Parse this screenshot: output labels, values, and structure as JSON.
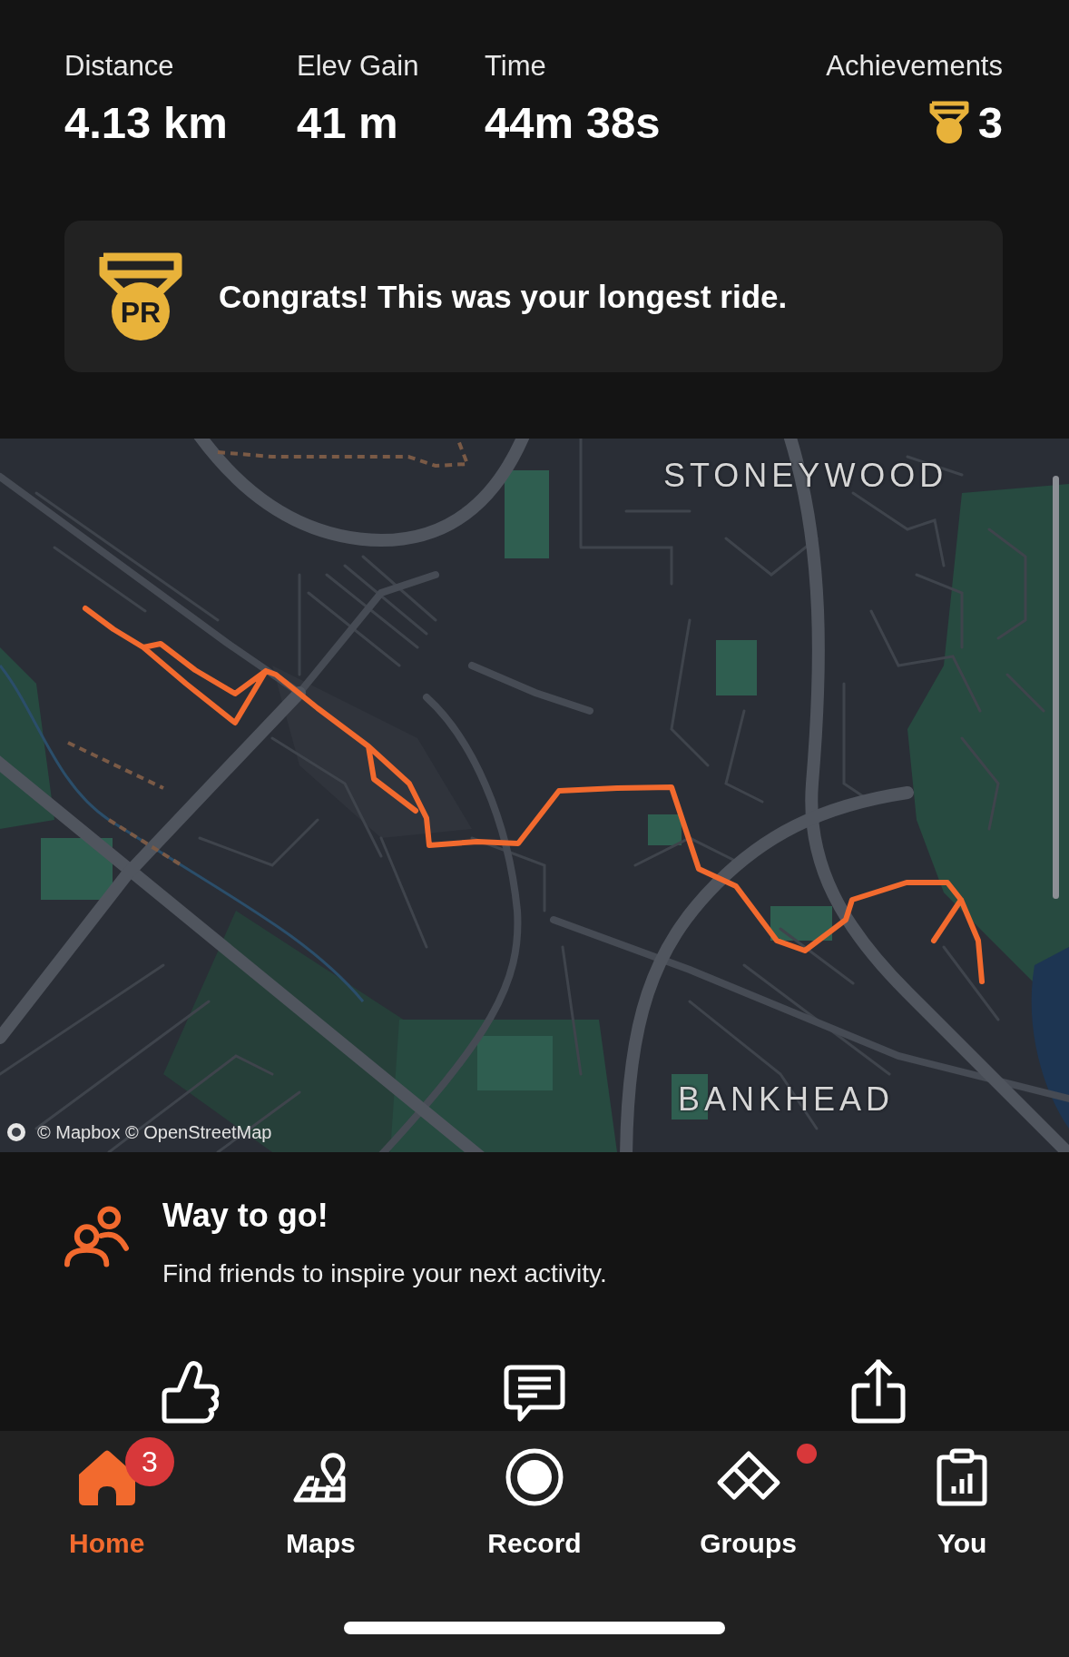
{
  "stats": [
    {
      "label": "Distance",
      "value": "4.13 km"
    },
    {
      "label": "Elev Gain",
      "value": "41 m"
    },
    {
      "label": "Time",
      "value": "44m 38s"
    }
  ],
  "achievements": {
    "label": "Achievements",
    "count": "3"
  },
  "pr_banner": {
    "badge_text": "PR",
    "message": "Congrats! This was your longest ride."
  },
  "map": {
    "place_labels": [
      "STONEYWOOD",
      "BANKHEAD"
    ],
    "attribution": "© Mapbox © OpenStreetMap"
  },
  "friends_prompt": {
    "title": "Way to go!",
    "message": "Find friends to inspire your next activity."
  },
  "tab_bar": {
    "tabs": [
      {
        "label": "Home",
        "selected": true,
        "badge": "3",
        "notification_dot": false
      },
      {
        "label": "Maps",
        "selected": false,
        "notification_dot": false
      },
      {
        "label": "Record",
        "selected": false,
        "notification_dot": false
      },
      {
        "label": "Groups",
        "selected": false,
        "notification_dot": true
      },
      {
        "label": "You",
        "selected": false,
        "notification_dot": false
      }
    ]
  }
}
